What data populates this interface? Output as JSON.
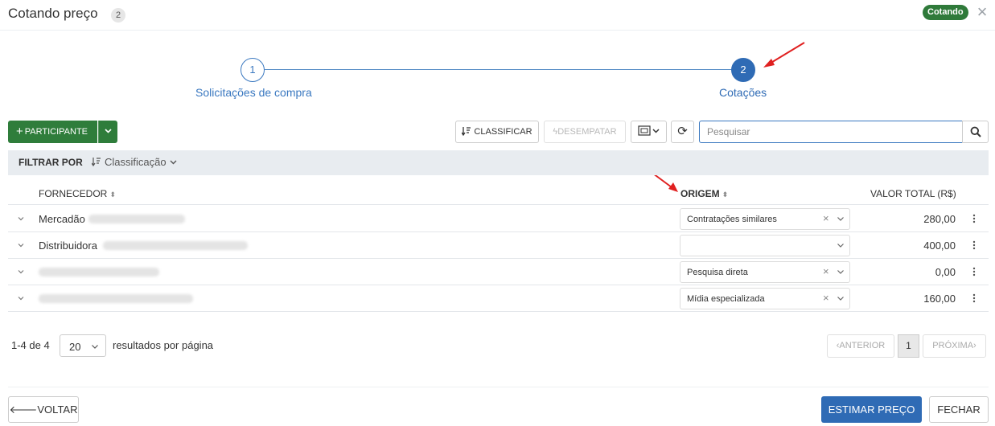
{
  "header": {
    "title": "Cotando preço",
    "count": "2",
    "status_badge": "Cotando",
    "close_icon": "close-icon",
    "status_color": "#2f7a3a"
  },
  "stepper": {
    "steps": [
      {
        "number": "1",
        "label": "Solicitações de compra"
      },
      {
        "number": "2",
        "label": "Cotações"
      }
    ],
    "active_color": "#2f6bb5"
  },
  "toolbar": {
    "participant_label": "PARTICIPANTE",
    "participant_color": "#2f7d3b",
    "classify_label": "CLASSIFICAR",
    "untie_label": "DESEMPATAR",
    "search_placeholder": "Pesquisar"
  },
  "filter": {
    "label": "FILTRAR POR",
    "selected": "Classificação"
  },
  "table": {
    "columns": {
      "supplier": "FORNECEDOR",
      "origin": "ORIGEM",
      "total": "VALOR TOTAL (R$)"
    },
    "rows": [
      {
        "supplier": "Mercadão",
        "origin": "Contratações similares",
        "total": "280,00"
      },
      {
        "supplier": "Distribuidora",
        "origin": "",
        "total": "400,00"
      },
      {
        "supplier": "",
        "origin": "Pesquisa direta",
        "total": "0,00"
      },
      {
        "supplier": "",
        "origin": "Mídia especializada",
        "total": "160,00"
      }
    ]
  },
  "pagination": {
    "range": "1-4 de 4",
    "per_page": "20",
    "per_page_label": "resultados por página",
    "prev": "ANTERIOR",
    "current": "1",
    "next": "PRÓXIMA"
  },
  "footer": {
    "back_label": "VOLTAR",
    "estimate_label": "ESTIMAR PREÇO",
    "close_label": "FECHAR"
  }
}
